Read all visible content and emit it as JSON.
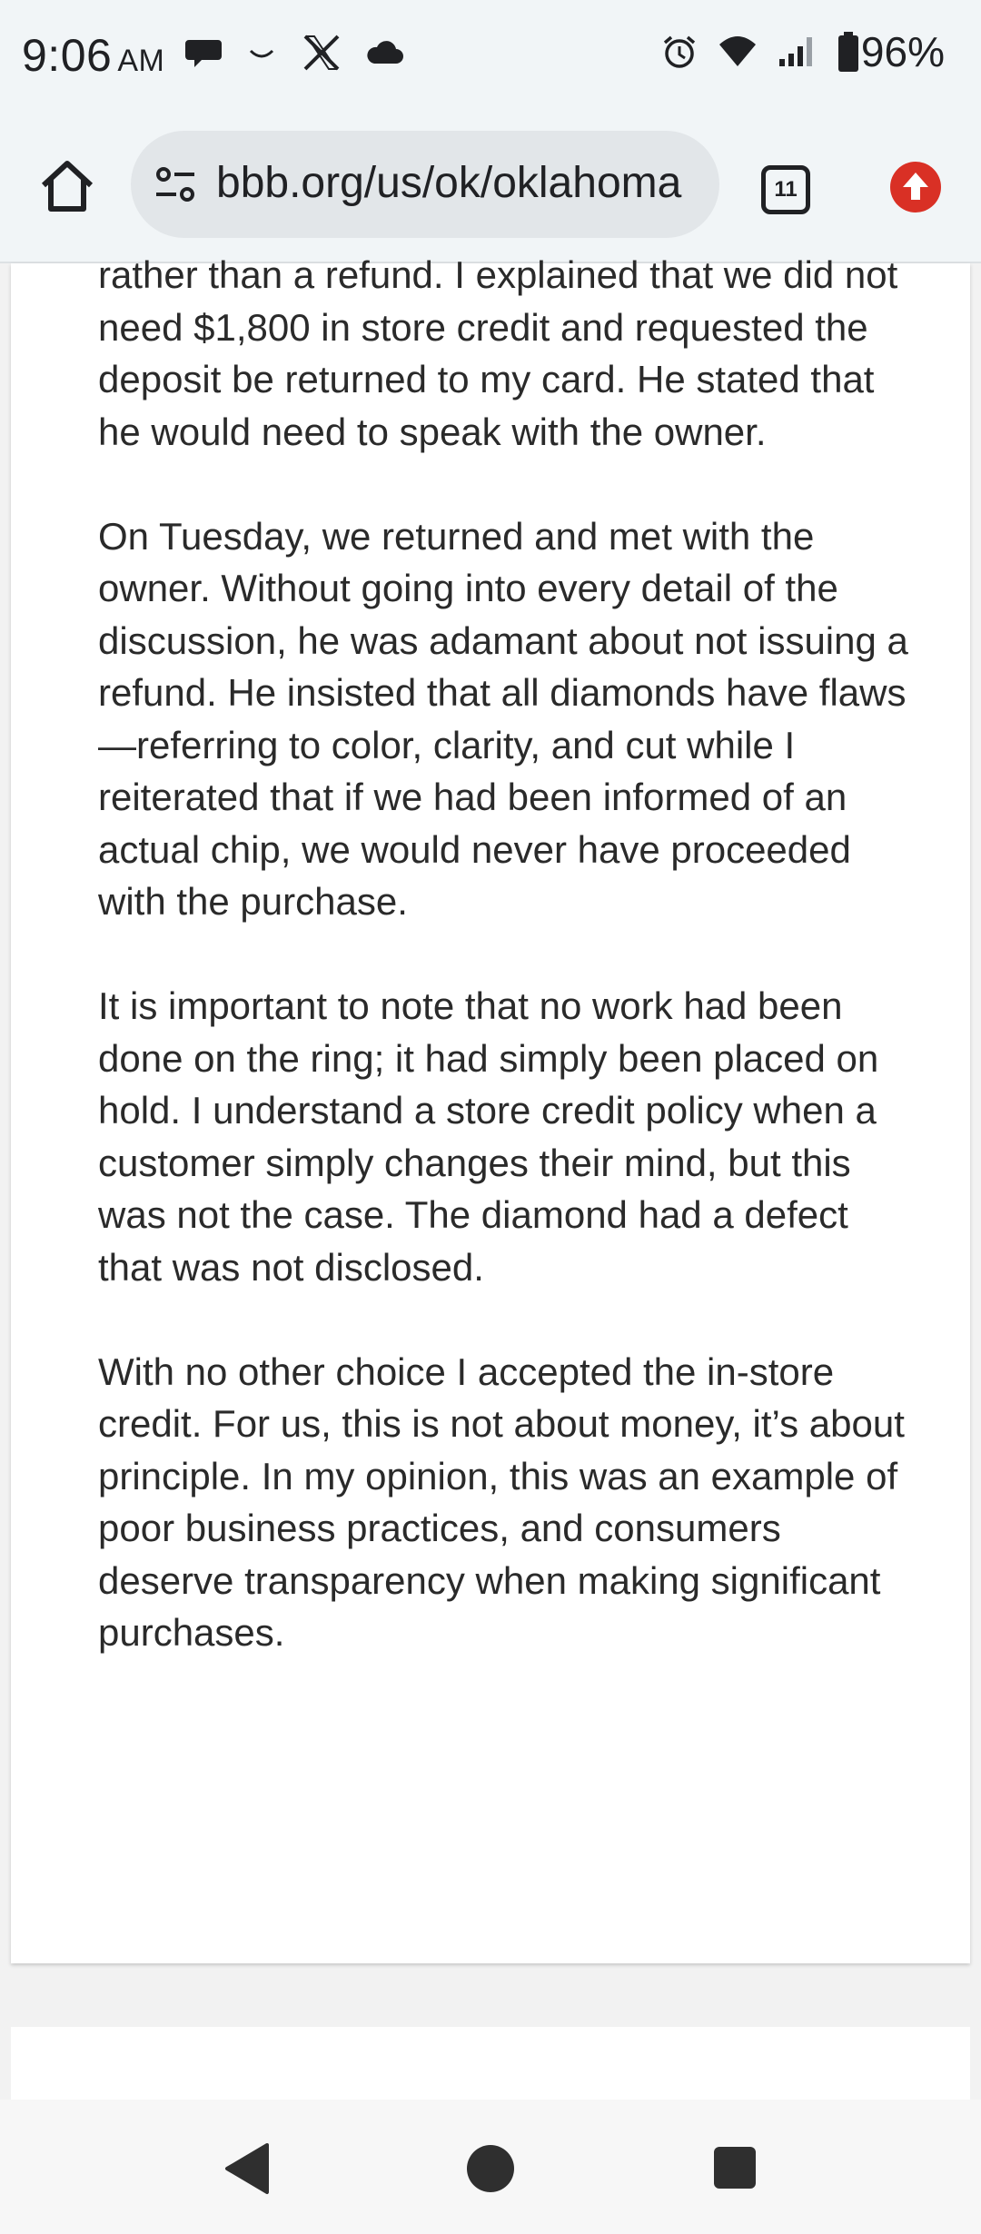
{
  "status_bar": {
    "time": "9:06",
    "ampm": "AM",
    "battery": "96%",
    "icons_left": [
      "chat-bubble-icon",
      "smile-icon",
      "x-logo-icon",
      "cloud-icon"
    ],
    "icons_right": [
      "alarm-icon",
      "wifi-icon",
      "signal-icon",
      "battery-icon"
    ]
  },
  "browser": {
    "url": "bbb.org/us/ok/oklahoma",
    "tab_count": "11",
    "accent_color": "#d93025"
  },
  "review": {
    "paragraphs": [
      "rather than a refund. I explained that we did not need $1,800 in store credit and requested the deposit be returned to my card. He stated that he would need to speak with the owner.",
      "On Tuesday, we returned and met with the owner. Without going into every detail of the discussion, he was adamant about not issuing a refund. He insisted that all diamonds have flaws—referring to color, clarity, and cut while I reiterated that if we had been informed of an actual chip, we would never have proceeded with the purchase.",
      "It is important to note that no work had been done on the ring; it had simply been placed on hold. I understand a store credit policy when a customer simply changes their mind, but this was not the case. The diamond had a defect that was not disclosed.",
      "With no other choice I accepted the in-store credit. For us, this is not about money, it’s about principle. In my opinion, this was an example of poor business practices, and consumers deserve transparency when making significant purchases."
    ]
  },
  "nav": {
    "icons": [
      "back-icon",
      "home-icon",
      "recents-icon"
    ]
  }
}
